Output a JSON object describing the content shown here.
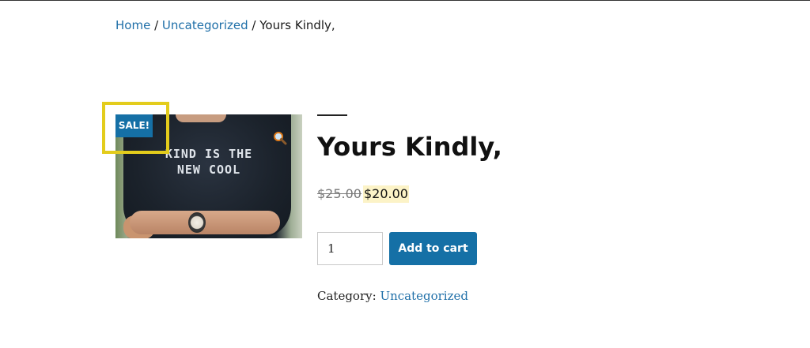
{
  "breadcrumb": {
    "home": "Home",
    "separator": "/",
    "category": "Uncategorized",
    "current": "Yours Kindly,"
  },
  "product": {
    "image_alt": "Man wearing black t-shirt printed KIND IS THE NEW COOL",
    "shirt_text_line1": "KIND IS THE",
    "shirt_text_line2": "NEW COOL",
    "sale_badge": "SALE!",
    "title": "Yours Kindly,",
    "regular_price": "$25.00",
    "sale_price": "$20.00",
    "quantity": "1",
    "add_to_cart_label": "Add to cart",
    "category_label": "Category:",
    "category_value": "Uncategorized",
    "zoom_icon": "magnifier-icon"
  },
  "colors": {
    "accent": "#1570a6",
    "link": "#1f6fa8",
    "highlight": "#e3cc1c",
    "sale_price_bg": "#fcf3c7"
  }
}
